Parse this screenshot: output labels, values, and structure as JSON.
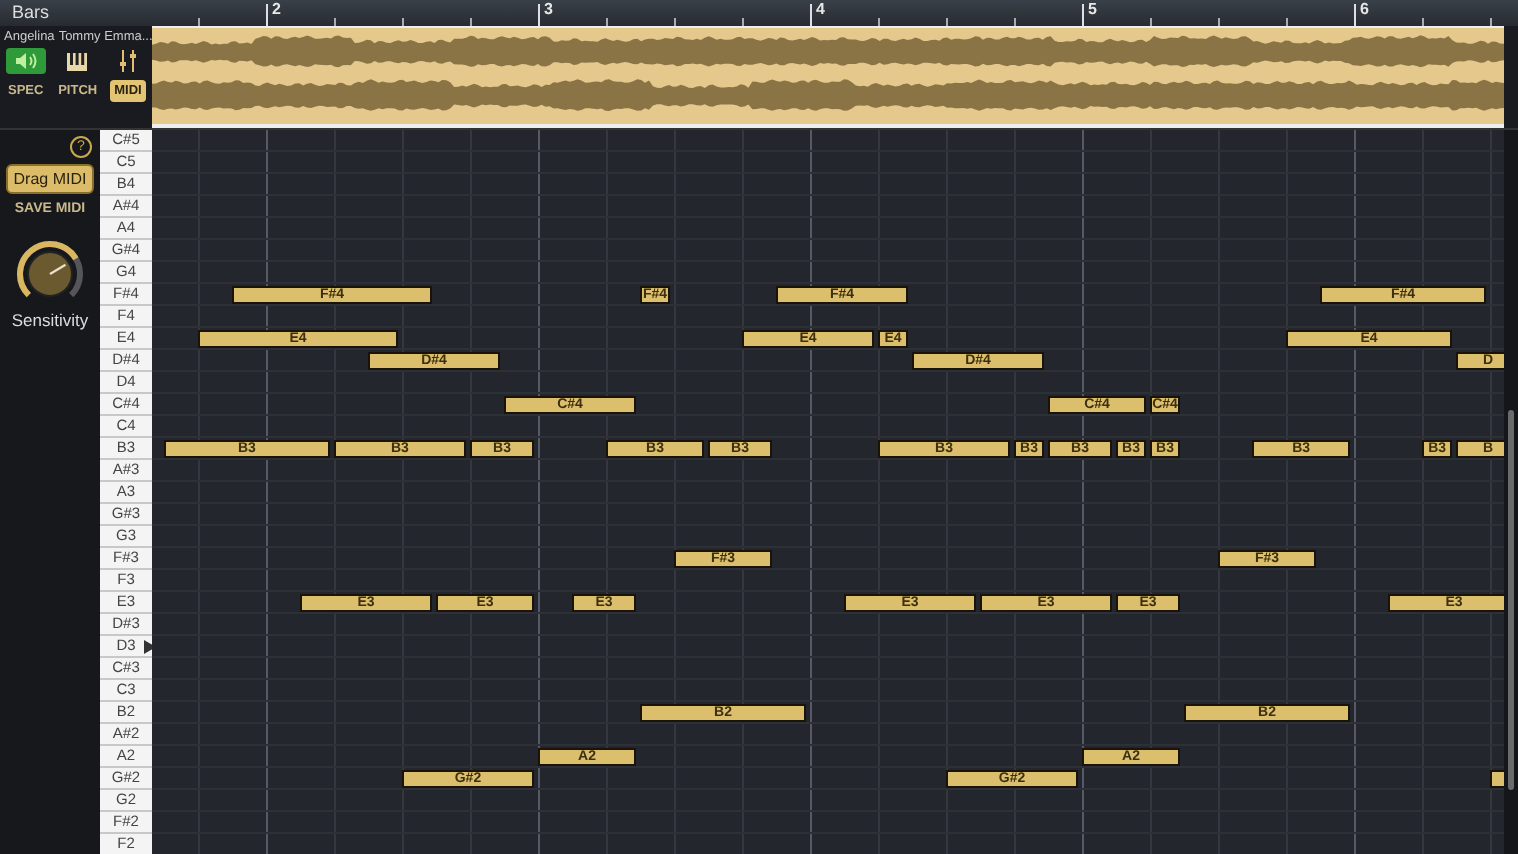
{
  "header": {
    "title": "Bars"
  },
  "ruler": {
    "labels": [
      "2",
      "3",
      "4",
      "5",
      "6"
    ]
  },
  "track": {
    "names": [
      "Angelina",
      "Tommy Emma..."
    ]
  },
  "view_modes": [
    {
      "label": "SPEC",
      "selected": false
    },
    {
      "label": "PITCH",
      "selected": false
    },
    {
      "label": "MIDI",
      "selected": true
    }
  ],
  "side_panel": {
    "drag_button": "Drag MIDI",
    "save_button": "SAVE MIDI",
    "help": "?",
    "knob": {
      "label": "Sensitivity",
      "level": 0.72
    }
  },
  "rows": [
    {
      "key": "C#5"
    },
    {
      "key": "C5"
    },
    {
      "key": "B4"
    },
    {
      "key": "A#4"
    },
    {
      "key": "A4"
    },
    {
      "key": "G#4"
    },
    {
      "key": "G4"
    },
    {
      "key": "F#4",
      "cells": [
        {
          "kind": "rest"
        },
        {
          "kind": "rest"
        },
        {
          "kind": "note",
          "label": "F#4"
        },
        {
          "kind": "hold"
        },
        {
          "kind": "hold"
        },
        {
          "kind": "hold"
        },
        {
          "kind": "hold"
        },
        {
          "kind": "hold"
        },
        {
          "kind": "rest"
        },
        {
          "kind": "rest"
        },
        {
          "kind": "rest"
        },
        {
          "kind": "rest"
        },
        {
          "kind": "rest"
        },
        {
          "kind": "rest"
        },
        {
          "kind": "note",
          "label": "F#4"
        },
        {
          "kind": "rest"
        },
        {
          "kind": "rest"
        },
        {
          "kind": "rest"
        },
        {
          "kind": "note",
          "label": "F#4"
        },
        {
          "kind": "hold"
        },
        {
          "kind": "hold"
        },
        {
          "kind": "hold"
        },
        {
          "kind": "rest"
        },
        {
          "kind": "rest"
        },
        {
          "kind": "rest"
        },
        {
          "kind": "rest"
        },
        {
          "kind": "rest"
        },
        {
          "kind": "rest"
        },
        {
          "kind": "rest"
        },
        {
          "kind": "rest"
        },
        {
          "kind": "rest"
        },
        {
          "kind": "rest"
        },
        {
          "kind": "rest"
        },
        {
          "kind": "rest"
        },
        {
          "kind": "note",
          "label": "F#4"
        },
        {
          "kind": "hold"
        },
        {
          "kind": "hold"
        },
        {
          "kind": "hold"
        },
        {
          "kind": "hold"
        }
      ]
    },
    {
      "key": "F4"
    },
    {
      "key": "E4",
      "cells": [
        {
          "kind": "rest"
        },
        {
          "kind": "note",
          "label": "E4"
        },
        {
          "kind": "hold"
        },
        {
          "kind": "hold"
        },
        {
          "kind": "hold"
        },
        {
          "kind": "hold"
        },
        {
          "kind": "hold"
        },
        {
          "kind": "rest"
        },
        {
          "kind": "rest"
        },
        {
          "kind": "rest"
        },
        {
          "kind": "rest"
        },
        {
          "kind": "rest"
        },
        {
          "kind": "rest"
        },
        {
          "kind": "rest"
        },
        {
          "kind": "rest"
        },
        {
          "kind": "rest"
        },
        {
          "kind": "rest"
        },
        {
          "kind": "note",
          "label": "E4"
        },
        {
          "kind": "hold"
        },
        {
          "kind": "hold"
        },
        {
          "kind": "hold"
        },
        {
          "kind": "note",
          "label": "E4"
        },
        {
          "kind": "rest"
        },
        {
          "kind": "rest"
        },
        {
          "kind": "rest"
        },
        {
          "kind": "rest"
        },
        {
          "kind": "rest"
        },
        {
          "kind": "rest"
        },
        {
          "kind": "rest"
        },
        {
          "kind": "rest"
        },
        {
          "kind": "rest"
        },
        {
          "kind": "rest"
        },
        {
          "kind": "rest"
        },
        {
          "kind": "note",
          "label": "E4"
        },
        {
          "kind": "hold"
        },
        {
          "kind": "hold"
        },
        {
          "kind": "hold"
        },
        {
          "kind": "hold"
        }
      ]
    },
    {
      "key": "D#4",
      "cells": [
        {
          "kind": "rest"
        },
        {
          "kind": "rest"
        },
        {
          "kind": "rest"
        },
        {
          "kind": "rest"
        },
        {
          "kind": "rest"
        },
        {
          "kind": "rest"
        },
        {
          "kind": "note",
          "label": "D#4"
        },
        {
          "kind": "hold"
        },
        {
          "kind": "hold"
        },
        {
          "kind": "hold"
        },
        {
          "kind": "rest"
        },
        {
          "kind": "rest"
        },
        {
          "kind": "rest"
        },
        {
          "kind": "rest"
        },
        {
          "kind": "rest"
        },
        {
          "kind": "rest"
        },
        {
          "kind": "rest"
        },
        {
          "kind": "rest"
        },
        {
          "kind": "rest"
        },
        {
          "kind": "rest"
        },
        {
          "kind": "rest"
        },
        {
          "kind": "rest"
        },
        {
          "kind": "note",
          "label": "D#4"
        },
        {
          "kind": "hold"
        },
        {
          "kind": "hold"
        },
        {
          "kind": "hold"
        },
        {
          "kind": "rest"
        },
        {
          "kind": "rest"
        },
        {
          "kind": "rest"
        },
        {
          "kind": "rest"
        },
        {
          "kind": "rest"
        },
        {
          "kind": "rest"
        },
        {
          "kind": "rest"
        },
        {
          "kind": "rest"
        },
        {
          "kind": "rest"
        },
        {
          "kind": "rest"
        },
        {
          "kind": "rest"
        },
        {
          "kind": "rest"
        },
        {
          "kind": "note",
          "label": "D"
        },
        {
          "kind": "hold"
        }
      ]
    },
    {
      "key": "D4"
    },
    {
      "key": "C#4",
      "cells": [
        {
          "kind": "rest"
        },
        {
          "kind": "rest"
        },
        {
          "kind": "rest"
        },
        {
          "kind": "rest"
        },
        {
          "kind": "rest"
        },
        {
          "kind": "rest"
        },
        {
          "kind": "rest"
        },
        {
          "kind": "rest"
        },
        {
          "kind": "rest"
        },
        {
          "kind": "rest"
        },
        {
          "kind": "note",
          "label": "C#4"
        },
        {
          "kind": "hold"
        },
        {
          "kind": "hold"
        },
        {
          "kind": "hold"
        },
        {
          "kind": "rest"
        },
        {
          "kind": "rest"
        },
        {
          "kind": "rest"
        },
        {
          "kind": "rest"
        },
        {
          "kind": "rest"
        },
        {
          "kind": "rest"
        },
        {
          "kind": "rest"
        },
        {
          "kind": "rest"
        },
        {
          "kind": "rest"
        },
        {
          "kind": "rest"
        },
        {
          "kind": "rest"
        },
        {
          "kind": "rest"
        },
        {
          "kind": "note",
          "label": "C#4"
        },
        {
          "kind": "hold"
        },
        {
          "kind": "hold"
        },
        {
          "kind": "note",
          "label": "C#4"
        }
      ]
    },
    {
      "key": "C4"
    },
    {
      "key": "B3",
      "cells": [
        {
          "kind": "note",
          "label": "B3"
        },
        {
          "kind": "hold"
        },
        {
          "kind": "hold"
        },
        {
          "kind": "hold"
        },
        {
          "kind": "hold"
        },
        {
          "kind": "note",
          "label": "B3"
        },
        {
          "kind": "hold"
        },
        {
          "kind": "hold"
        },
        {
          "kind": "hold"
        },
        {
          "kind": "note",
          "label": "B3"
        },
        {
          "kind": "hold"
        },
        {
          "kind": "rest"
        },
        {
          "kind": "rest"
        },
        {
          "kind": "note",
          "label": "B3"
        },
        {
          "kind": "hold"
        },
        {
          "kind": "hold"
        },
        {
          "kind": "note",
          "label": "B3"
        },
        {
          "kind": "hold"
        },
        {
          "kind": "rest"
        },
        {
          "kind": "rest"
        },
        {
          "kind": "rest"
        },
        {
          "kind": "note",
          "label": "B3"
        },
        {
          "kind": "hold"
        },
        {
          "kind": "hold"
        },
        {
          "kind": "hold"
        },
        {
          "kind": "note",
          "label": "B3"
        },
        {
          "kind": "note",
          "label": "B3"
        },
        {
          "kind": "hold"
        },
        {
          "kind": "note",
          "label": "B3"
        },
        {
          "kind": "note",
          "label": "B3"
        },
        {
          "kind": "rest"
        },
        {
          "kind": "rest"
        },
        {
          "kind": "note",
          "label": "B3"
        },
        {
          "kind": "hold"
        },
        {
          "kind": "hold"
        },
        {
          "kind": "rest"
        },
        {
          "kind": "rest"
        },
        {
          "kind": "note",
          "label": "B3"
        },
        {
          "kind": "note",
          "label": "B"
        },
        {
          "kind": "hold"
        }
      ]
    },
    {
      "key": "A#3"
    },
    {
      "key": "A3"
    },
    {
      "key": "G#3"
    },
    {
      "key": "G3"
    },
    {
      "key": "F#3",
      "cells": [
        {
          "kind": "rest"
        },
        {
          "kind": "rest"
        },
        {
          "kind": "rest"
        },
        {
          "kind": "rest"
        },
        {
          "kind": "rest"
        },
        {
          "kind": "rest"
        },
        {
          "kind": "rest"
        },
        {
          "kind": "rest"
        },
        {
          "kind": "rest"
        },
        {
          "kind": "rest"
        },
        {
          "kind": "rest"
        },
        {
          "kind": "rest"
        },
        {
          "kind": "rest"
        },
        {
          "kind": "rest"
        },
        {
          "kind": "rest"
        },
        {
          "kind": "note",
          "label": "F#3"
        },
        {
          "kind": "hold"
        },
        {
          "kind": "hold"
        },
        {
          "kind": "rest"
        },
        {
          "kind": "rest"
        },
        {
          "kind": "rest"
        },
        {
          "kind": "rest"
        },
        {
          "kind": "rest"
        },
        {
          "kind": "rest"
        },
        {
          "kind": "rest"
        },
        {
          "kind": "rest"
        },
        {
          "kind": "rest"
        },
        {
          "kind": "rest"
        },
        {
          "kind": "rest"
        },
        {
          "kind": "rest"
        },
        {
          "kind": "rest"
        },
        {
          "kind": "note",
          "label": "F#3"
        },
        {
          "kind": "hold"
        },
        {
          "kind": "hold"
        }
      ]
    },
    {
      "key": "F3"
    },
    {
      "key": "E3",
      "cells": [
        {
          "kind": "rest"
        },
        {
          "kind": "rest"
        },
        {
          "kind": "rest"
        },
        {
          "kind": "rest"
        },
        {
          "kind": "note",
          "label": "E3"
        },
        {
          "kind": "hold"
        },
        {
          "kind": "hold"
        },
        {
          "kind": "hold"
        },
        {
          "kind": "note",
          "label": "E3"
        },
        {
          "kind": "hold"
        },
        {
          "kind": "hold"
        },
        {
          "kind": "rest"
        },
        {
          "kind": "note",
          "label": "E3"
        },
        {
          "kind": "hold"
        },
        {
          "kind": "rest"
        },
        {
          "kind": "rest"
        },
        {
          "kind": "rest"
        },
        {
          "kind": "rest"
        },
        {
          "kind": "rest"
        },
        {
          "kind": "rest"
        },
        {
          "kind": "note",
          "label": "E3"
        },
        {
          "kind": "hold"
        },
        {
          "kind": "hold"
        },
        {
          "kind": "hold"
        },
        {
          "kind": "note",
          "label": "E3"
        },
        {
          "kind": "hold"
        },
        {
          "kind": "hold"
        },
        {
          "kind": "hold"
        },
        {
          "kind": "note",
          "label": "E3"
        },
        {
          "kind": "hold"
        },
        {
          "kind": "rest"
        },
        {
          "kind": "rest"
        },
        {
          "kind": "rest"
        },
        {
          "kind": "rest"
        },
        {
          "kind": "rest"
        },
        {
          "kind": "rest"
        },
        {
          "kind": "note",
          "label": "E3"
        },
        {
          "kind": "hold"
        },
        {
          "kind": "hold"
        },
        {
          "kind": "hold"
        }
      ]
    },
    {
      "key": "D#3"
    },
    {
      "key": "D3",
      "playhead": true
    },
    {
      "key": "C#3"
    },
    {
      "key": "C3"
    },
    {
      "key": "B2",
      "cells": [
        {
          "kind": "rest"
        },
        {
          "kind": "rest"
        },
        {
          "kind": "rest"
        },
        {
          "kind": "rest"
        },
        {
          "kind": "rest"
        },
        {
          "kind": "rest"
        },
        {
          "kind": "rest"
        },
        {
          "kind": "rest"
        },
        {
          "kind": "rest"
        },
        {
          "kind": "rest"
        },
        {
          "kind": "rest"
        },
        {
          "kind": "rest"
        },
        {
          "kind": "rest"
        },
        {
          "kind": "rest"
        },
        {
          "kind": "note",
          "label": "B2"
        },
        {
          "kind": "hold"
        },
        {
          "kind": "hold"
        },
        {
          "kind": "hold"
        },
        {
          "kind": "hold"
        },
        {
          "kind": "rest"
        },
        {
          "kind": "rest"
        },
        {
          "kind": "rest"
        },
        {
          "kind": "rest"
        },
        {
          "kind": "rest"
        },
        {
          "kind": "rest"
        },
        {
          "kind": "rest"
        },
        {
          "kind": "rest"
        },
        {
          "kind": "rest"
        },
        {
          "kind": "rest"
        },
        {
          "kind": "rest"
        },
        {
          "kind": "note",
          "label": "B2"
        },
        {
          "kind": "hold"
        },
        {
          "kind": "hold"
        },
        {
          "kind": "hold"
        },
        {
          "kind": "hold"
        }
      ]
    },
    {
      "key": "A#2"
    },
    {
      "key": "A2",
      "cells": [
        {
          "kind": "rest"
        },
        {
          "kind": "rest"
        },
        {
          "kind": "rest"
        },
        {
          "kind": "rest"
        },
        {
          "kind": "rest"
        },
        {
          "kind": "rest"
        },
        {
          "kind": "rest"
        },
        {
          "kind": "rest"
        },
        {
          "kind": "rest"
        },
        {
          "kind": "rest"
        },
        {
          "kind": "rest"
        },
        {
          "kind": "note",
          "label": "A2"
        },
        {
          "kind": "hold"
        },
        {
          "kind": "hold"
        },
        {
          "kind": "rest"
        },
        {
          "kind": "rest"
        },
        {
          "kind": "rest"
        },
        {
          "kind": "rest"
        },
        {
          "kind": "rest"
        },
        {
          "kind": "rest"
        },
        {
          "kind": "rest"
        },
        {
          "kind": "rest"
        },
        {
          "kind": "rest"
        },
        {
          "kind": "rest"
        },
        {
          "kind": "rest"
        },
        {
          "kind": "rest"
        },
        {
          "kind": "rest"
        },
        {
          "kind": "note",
          "label": "A2"
        },
        {
          "kind": "hold"
        },
        {
          "kind": "hold"
        }
      ]
    },
    {
      "key": "G#2",
      "cells": [
        {
          "kind": "rest"
        },
        {
          "kind": "rest"
        },
        {
          "kind": "rest"
        },
        {
          "kind": "rest"
        },
        {
          "kind": "rest"
        },
        {
          "kind": "rest"
        },
        {
          "kind": "rest"
        },
        {
          "kind": "note",
          "label": "G#2"
        },
        {
          "kind": "hold"
        },
        {
          "kind": "hold"
        },
        {
          "kind": "hold"
        },
        {
          "kind": "rest"
        },
        {
          "kind": "rest"
        },
        {
          "kind": "rest"
        },
        {
          "kind": "rest"
        },
        {
          "kind": "rest"
        },
        {
          "kind": "rest"
        },
        {
          "kind": "rest"
        },
        {
          "kind": "rest"
        },
        {
          "kind": "rest"
        },
        {
          "kind": "rest"
        },
        {
          "kind": "rest"
        },
        {
          "kind": "rest"
        },
        {
          "kind": "note",
          "label": "G#2"
        },
        {
          "kind": "hold"
        },
        {
          "kind": "hold"
        },
        {
          "kind": "hold"
        },
        {
          "kind": "rest"
        },
        {
          "kind": "rest"
        },
        {
          "kind": "rest"
        },
        {
          "kind": "rest"
        },
        {
          "kind": "rest"
        },
        {
          "kind": "rest"
        },
        {
          "kind": "rest"
        },
        {
          "kind": "rest"
        },
        {
          "kind": "rest"
        },
        {
          "kind": "rest"
        },
        {
          "kind": "rest"
        },
        {
          "kind": "rest"
        },
        {
          "kind": "note"
        }
      ]
    },
    {
      "key": "G2"
    },
    {
      "key": "F#2"
    },
    {
      "key": "F2"
    }
  ]
}
